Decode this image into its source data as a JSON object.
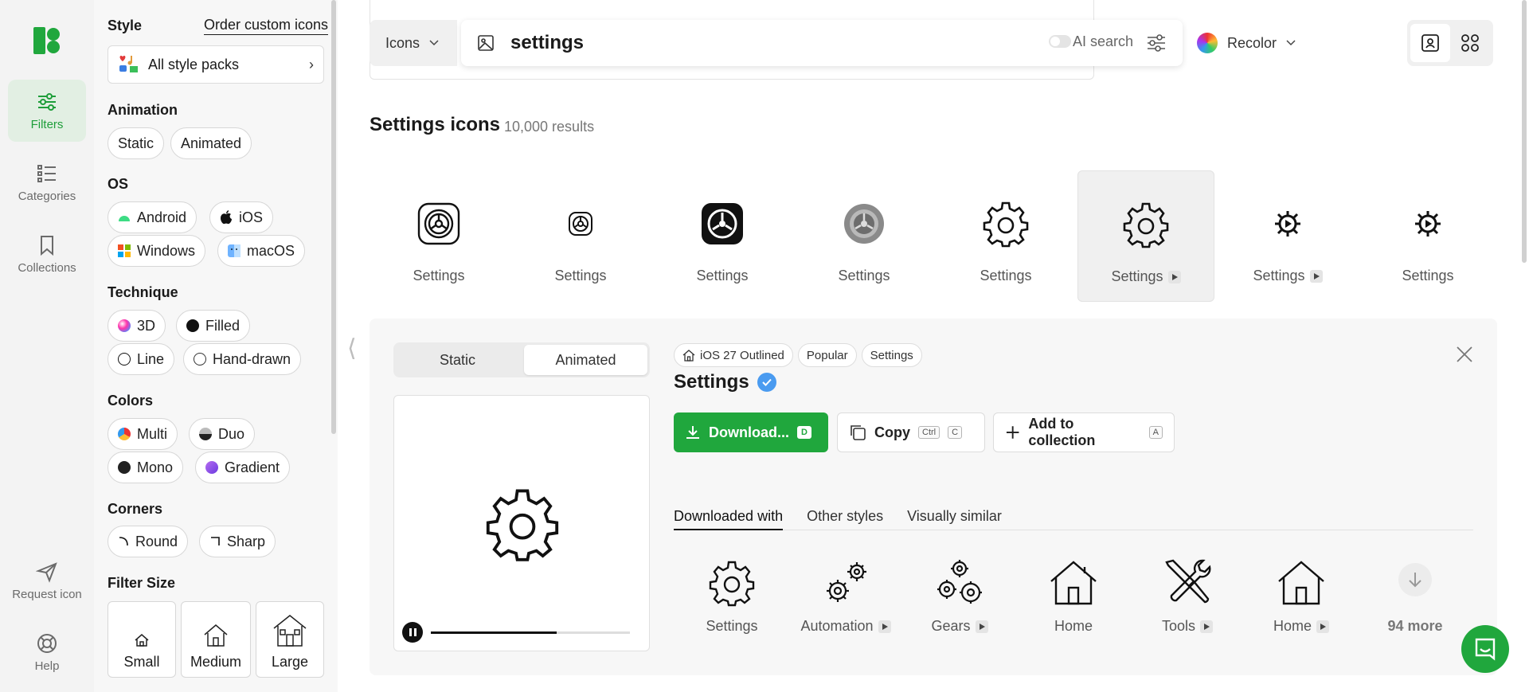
{
  "rail": {
    "filters": "Filters",
    "categories": "Categories",
    "collections": "Collections",
    "request": "Request icon",
    "help": "Help"
  },
  "panel": {
    "style_title": "Style",
    "order_link": "Order custom icons",
    "style_packs": "All style packs",
    "animation_title": "Animation",
    "animation": [
      "Static",
      "Animated"
    ],
    "os_title": "OS",
    "os": [
      "Android",
      "iOS",
      "Windows",
      "macOS"
    ],
    "technique_title": "Technique",
    "technique": [
      "3D",
      "Filled",
      "Line",
      "Hand-drawn"
    ],
    "colors_title": "Colors",
    "colors": [
      "Multi",
      "Duo",
      "Mono",
      "Gradient"
    ],
    "corners_title": "Corners",
    "corners": [
      "Round",
      "Sharp"
    ],
    "size_title": "Filter Size",
    "sizes": [
      "Small",
      "Medium",
      "Large"
    ]
  },
  "search": {
    "type": "Icons",
    "query": "settings",
    "ai": "AI search",
    "recolor": "Recolor"
  },
  "results": {
    "title": "Settings icons",
    "count": "10,000 results",
    "items": [
      {
        "label": "Settings",
        "animated": false
      },
      {
        "label": "Settings",
        "animated": false
      },
      {
        "label": "Settings",
        "animated": false
      },
      {
        "label": "Settings",
        "animated": false
      },
      {
        "label": "Settings",
        "animated": false
      },
      {
        "label": "Settings",
        "animated": true
      },
      {
        "label": "Settings",
        "animated": true
      },
      {
        "label": "Settings",
        "animated": false
      }
    ]
  },
  "details": {
    "seg": [
      "Static",
      "Animated"
    ],
    "tags": [
      "iOS 27 Outlined",
      "Popular",
      "Settings"
    ],
    "title": "Settings",
    "download": "Download...",
    "download_key": "D",
    "copy": "Copy",
    "copy_key1": "Ctrl",
    "copy_key2": "C",
    "add": "Add to collection",
    "add_key": "A",
    "tabs": [
      "Downloaded with",
      "Other styles",
      "Visually similar"
    ],
    "related": [
      "Settings",
      "Automation",
      "Gears",
      "Home",
      "Tools",
      "Home"
    ],
    "more": "94 more",
    "progress": 0.63
  },
  "colors": {
    "brand": "#20a73d",
    "verified": "#4a9bf0"
  }
}
